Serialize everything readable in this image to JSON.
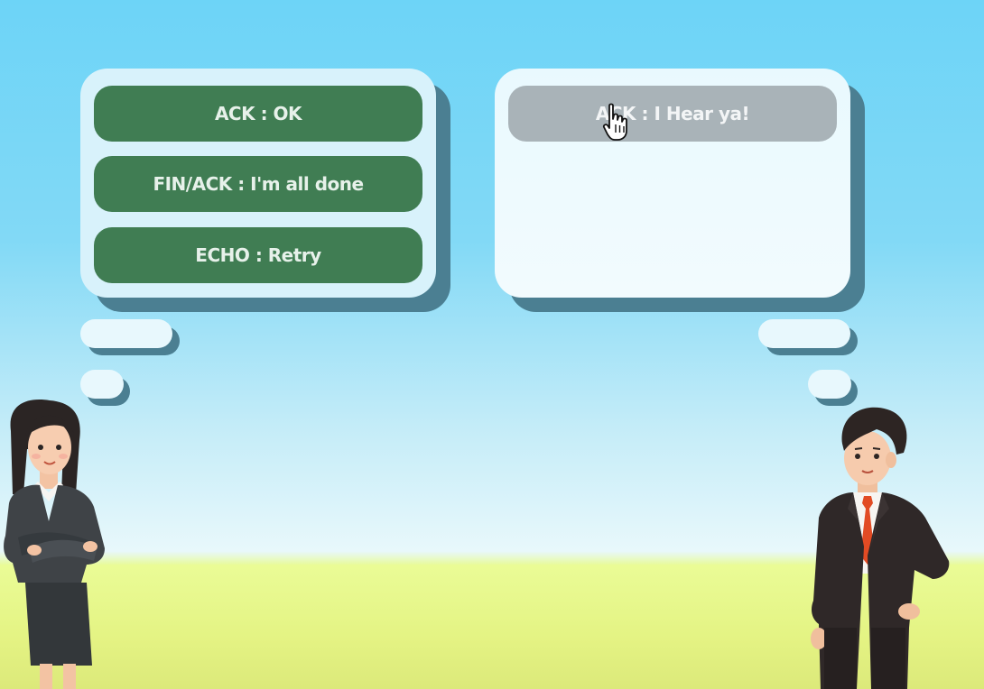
{
  "left_bubble": {
    "options": [
      {
        "label": "ACK : OK"
      },
      {
        "label": "FIN/ACK : I'm all done"
      },
      {
        "label": "ECHO : Retry"
      }
    ]
  },
  "right_bubble": {
    "options": [
      {
        "label": "ACK : I Hear ya!"
      }
    ]
  },
  "colors": {
    "option_green": "#407d53",
    "option_gray": "#a9b3b8",
    "sky": "#6dd4f7",
    "grass": "#e4f383"
  },
  "icons": [
    "hand-pointer-cursor-icon"
  ]
}
